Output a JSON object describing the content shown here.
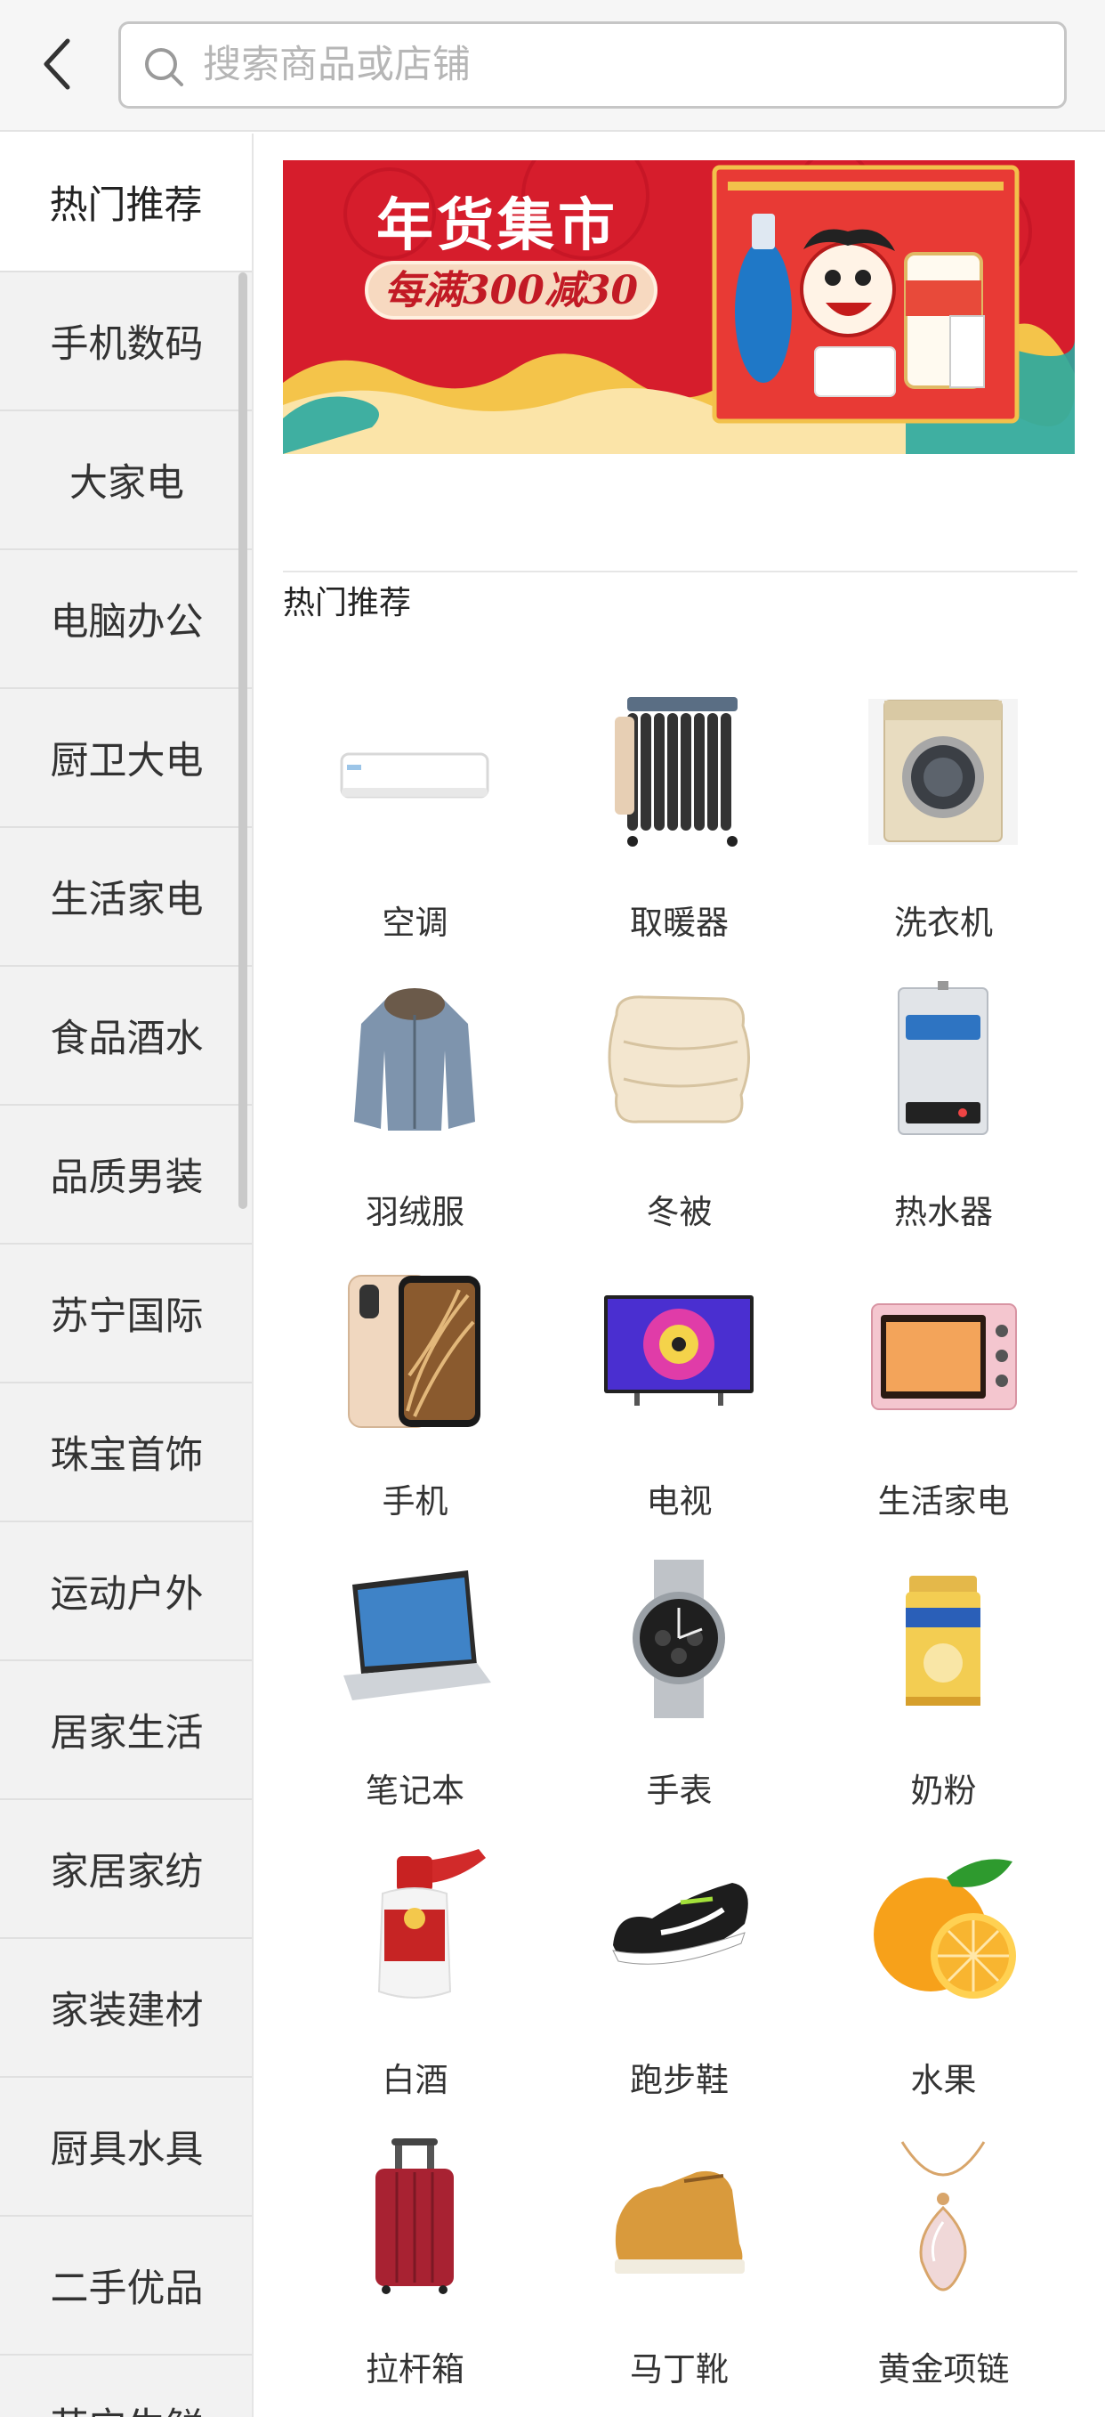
{
  "search": {
    "placeholder": "搜索商品或店铺",
    "value": ""
  },
  "sidebar": {
    "items": [
      {
        "label": "热门推荐",
        "active": true
      },
      {
        "label": "手机数码"
      },
      {
        "label": "大家电"
      },
      {
        "label": "电脑办公"
      },
      {
        "label": "厨卫大电"
      },
      {
        "label": "生活家电"
      },
      {
        "label": "食品酒水"
      },
      {
        "label": "品质男装"
      },
      {
        "label": "苏宁国际"
      },
      {
        "label": "珠宝首饰"
      },
      {
        "label": "运动户外"
      },
      {
        "label": "居家生活"
      },
      {
        "label": "家居家纺"
      },
      {
        "label": "家装建材"
      },
      {
        "label": "厨具水具"
      },
      {
        "label": "二手优品"
      },
      {
        "label": "苏宁生鲜"
      }
    ]
  },
  "banner": {
    "title": "年货集市",
    "subtitle": "每满300减30"
  },
  "section": {
    "title": "热门推荐"
  },
  "products": [
    {
      "label": "空调",
      "icon": "air-conditioner-icon"
    },
    {
      "label": "取暖器",
      "icon": "oil-heater-icon"
    },
    {
      "label": "洗衣机",
      "icon": "washing-machine-icon"
    },
    {
      "label": "羽绒服",
      "icon": "down-jacket-icon"
    },
    {
      "label": "冬被",
      "icon": "quilt-icon"
    },
    {
      "label": "热水器",
      "icon": "water-heater-icon"
    },
    {
      "label": "手机",
      "icon": "smartphone-icon"
    },
    {
      "label": "电视",
      "icon": "television-icon"
    },
    {
      "label": "生活家电",
      "icon": "oven-icon"
    },
    {
      "label": "笔记本",
      "icon": "laptop-icon"
    },
    {
      "label": "手表",
      "icon": "watch-icon"
    },
    {
      "label": "奶粉",
      "icon": "milk-powder-can-icon"
    },
    {
      "label": "白酒",
      "icon": "liquor-bottle-icon"
    },
    {
      "label": "跑步鞋",
      "icon": "running-shoe-icon"
    },
    {
      "label": "水果",
      "icon": "orange-fruit-icon"
    },
    {
      "label": "拉杆箱",
      "icon": "suitcase-icon"
    },
    {
      "label": "马丁靴",
      "icon": "boot-icon"
    },
    {
      "label": "黄金项链",
      "icon": "necklace-icon"
    }
  ],
  "colors": {
    "banner_red": "#d61d2c",
    "header_bg": "#f6f6f6",
    "sidebar_bg": "#f2f2f2"
  }
}
